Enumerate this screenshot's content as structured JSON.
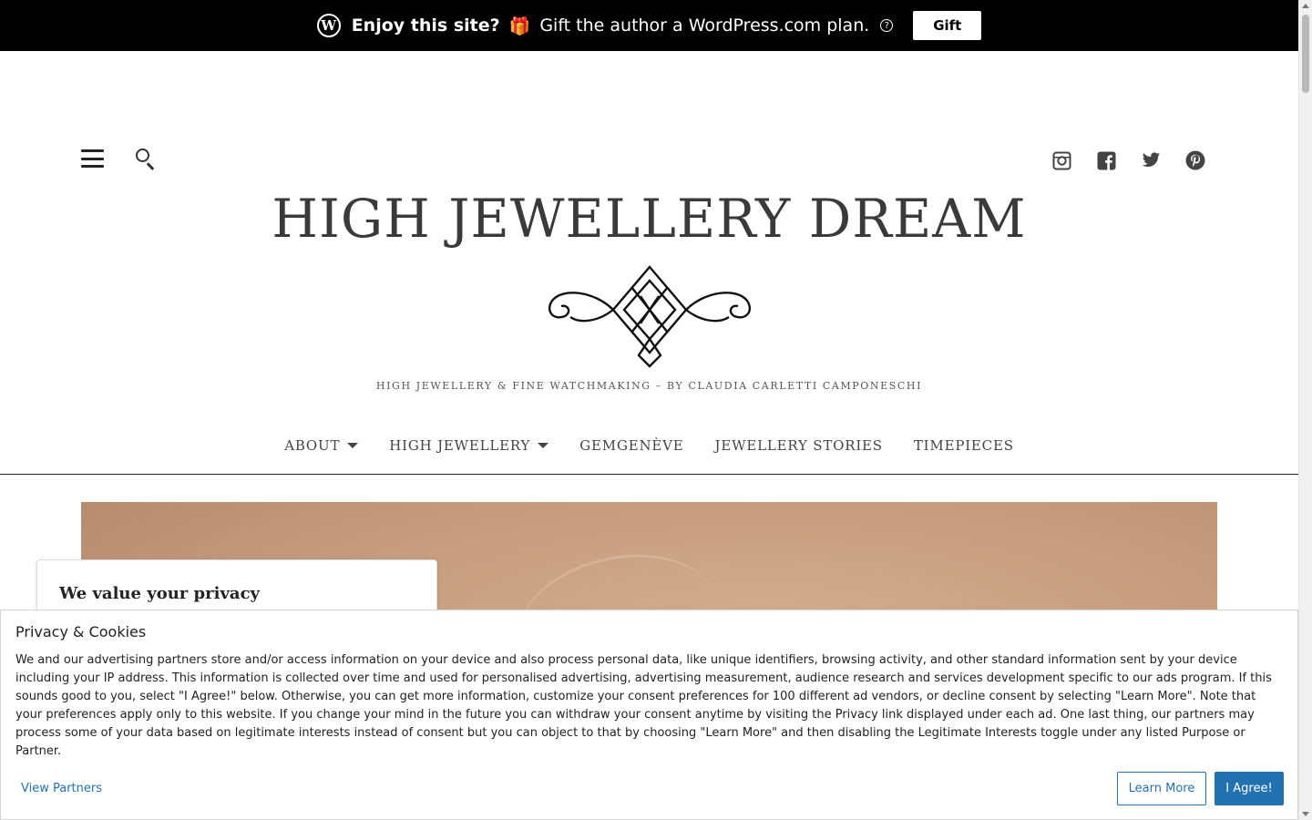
{
  "promo": {
    "logo_letter": "W",
    "strong_text": "Enjoy this site?",
    "gift_emoji": "🎁",
    "message": "Gift the author a WordPress.com plan.",
    "help_glyph": "?",
    "button_label": "Gift"
  },
  "header": {
    "title": "HIGH JEWELLERY DREAM",
    "tagline": "HIGH JEWELLERY & FINE WATCHMAKING – BY CLAUDIA CARLETTI CAMPONESCHI",
    "tools": [
      "menu-icon",
      "search-icon"
    ],
    "social": [
      "instagram-icon",
      "facebook-icon",
      "twitter-icon",
      "pinterest-icon"
    ]
  },
  "nav": {
    "items": [
      {
        "label": "ABOUT",
        "has_submenu": true
      },
      {
        "label": "HIGH JEWELLERY",
        "has_submenu": true
      },
      {
        "label": "GEMGENÈVE",
        "has_submenu": false
      },
      {
        "label": "JEWELLERY STORIES",
        "has_submenu": false
      },
      {
        "label": "TIMEPIECES",
        "has_submenu": false
      }
    ]
  },
  "privacy_card": {
    "title": "We value your privacy"
  },
  "cookie_banner": {
    "title": "Privacy & Cookies",
    "body": "We and our advertising partners store and/or access information on your device and also process personal data, like unique identifiers, browsing activity, and other standard information sent by your device including your IP address. This information is collected over time and used for personalised advertising, advertising measurement, audience research and services development specific to our ads program. If this sounds good to you, select \"I Agree!\" below. Otherwise, you can get more information, customize your consent preferences for 100 different ad vendors, or decline consent by selecting \"Learn More\". Note that your preferences apply only to this website. If you change your mind in the future you can withdraw your consent anytime by visiting the Privacy link displayed under each ad. One last thing, our partners may process some of your data based on legitimate interests instead of consent but you can object to that by choosing \"Learn More\" and then disabling the Legitimate Interests toggle under any listed Purpose or Partner.",
    "view_partners": "View Partners",
    "learn_more": "Learn More",
    "agree": "I Agree!"
  },
  "colors": {
    "promo_bg": "#000000",
    "link_blue": "#2271b1",
    "title_text": "#3a3a3a",
    "hero_tone": "#c8a081"
  }
}
